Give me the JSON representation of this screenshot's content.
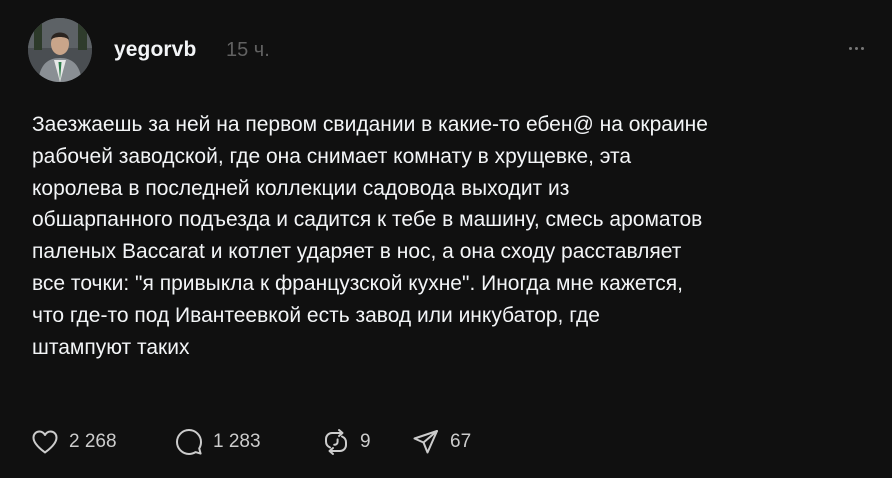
{
  "post": {
    "author": {
      "username": "yegorvb",
      "timestamp": "15 ч."
    },
    "text_lines": [
      "Заезжаешь за ней на первом свидании в какие-то ебен@ на окраине",
      "рабочей заводской, где она снимает комнату в хрущевке, эта",
      "королева в последней коллекции садовода выходит из",
      "обшарпанного подъезда и садится к тебе в машину, смесь ароматов",
      "паленых Baccarat и котлет ударяет в нос, а она сходу расставляет",
      "все точки: \"я привыкла к французской кухне\". Иногда мне кажется,",
      "что где-то под Ивантеевкой есть завод или инкубатор, где",
      "штампуют таких"
    ],
    "actions": {
      "like": {
        "icon": "heart-icon",
        "count": "2 268"
      },
      "comment": {
        "icon": "comment-icon",
        "count": "1 283"
      },
      "repost": {
        "icon": "repost-icon",
        "count": "9"
      },
      "share": {
        "icon": "share-icon",
        "count": "67"
      }
    },
    "menu": {
      "icon": "more-options-icon"
    }
  },
  "colors": {
    "background": "#101010",
    "text": "#f3f5f7",
    "muted": "#616161",
    "icon": "#cccccc"
  }
}
